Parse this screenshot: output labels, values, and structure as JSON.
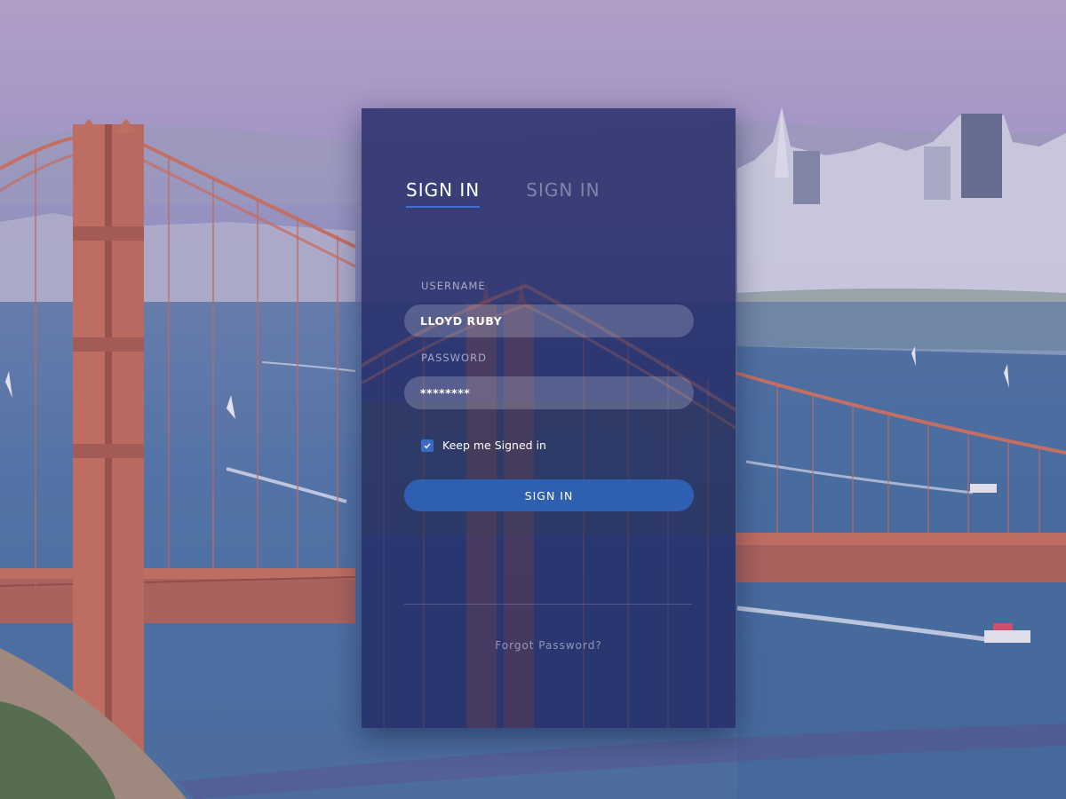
{
  "tabs": [
    {
      "label": "SIGN IN",
      "active": true
    },
    {
      "label": "SIGN IN",
      "active": false
    }
  ],
  "username": {
    "label": "USERNAME",
    "value": "LLOYD RUBY"
  },
  "password": {
    "label": "PASSWORD",
    "value": "********"
  },
  "remember": {
    "label": "Keep me Signed in",
    "checked": true
  },
  "submit": {
    "label": "SIGN IN"
  },
  "forgot": {
    "label": "Forgot Password?"
  },
  "colors": {
    "accent": "#2f5fb0",
    "card": "#202864",
    "tab_underline": "#3f6fd1",
    "bridge": "#c96a4e"
  },
  "icons": {
    "checkbox": "check-icon"
  }
}
